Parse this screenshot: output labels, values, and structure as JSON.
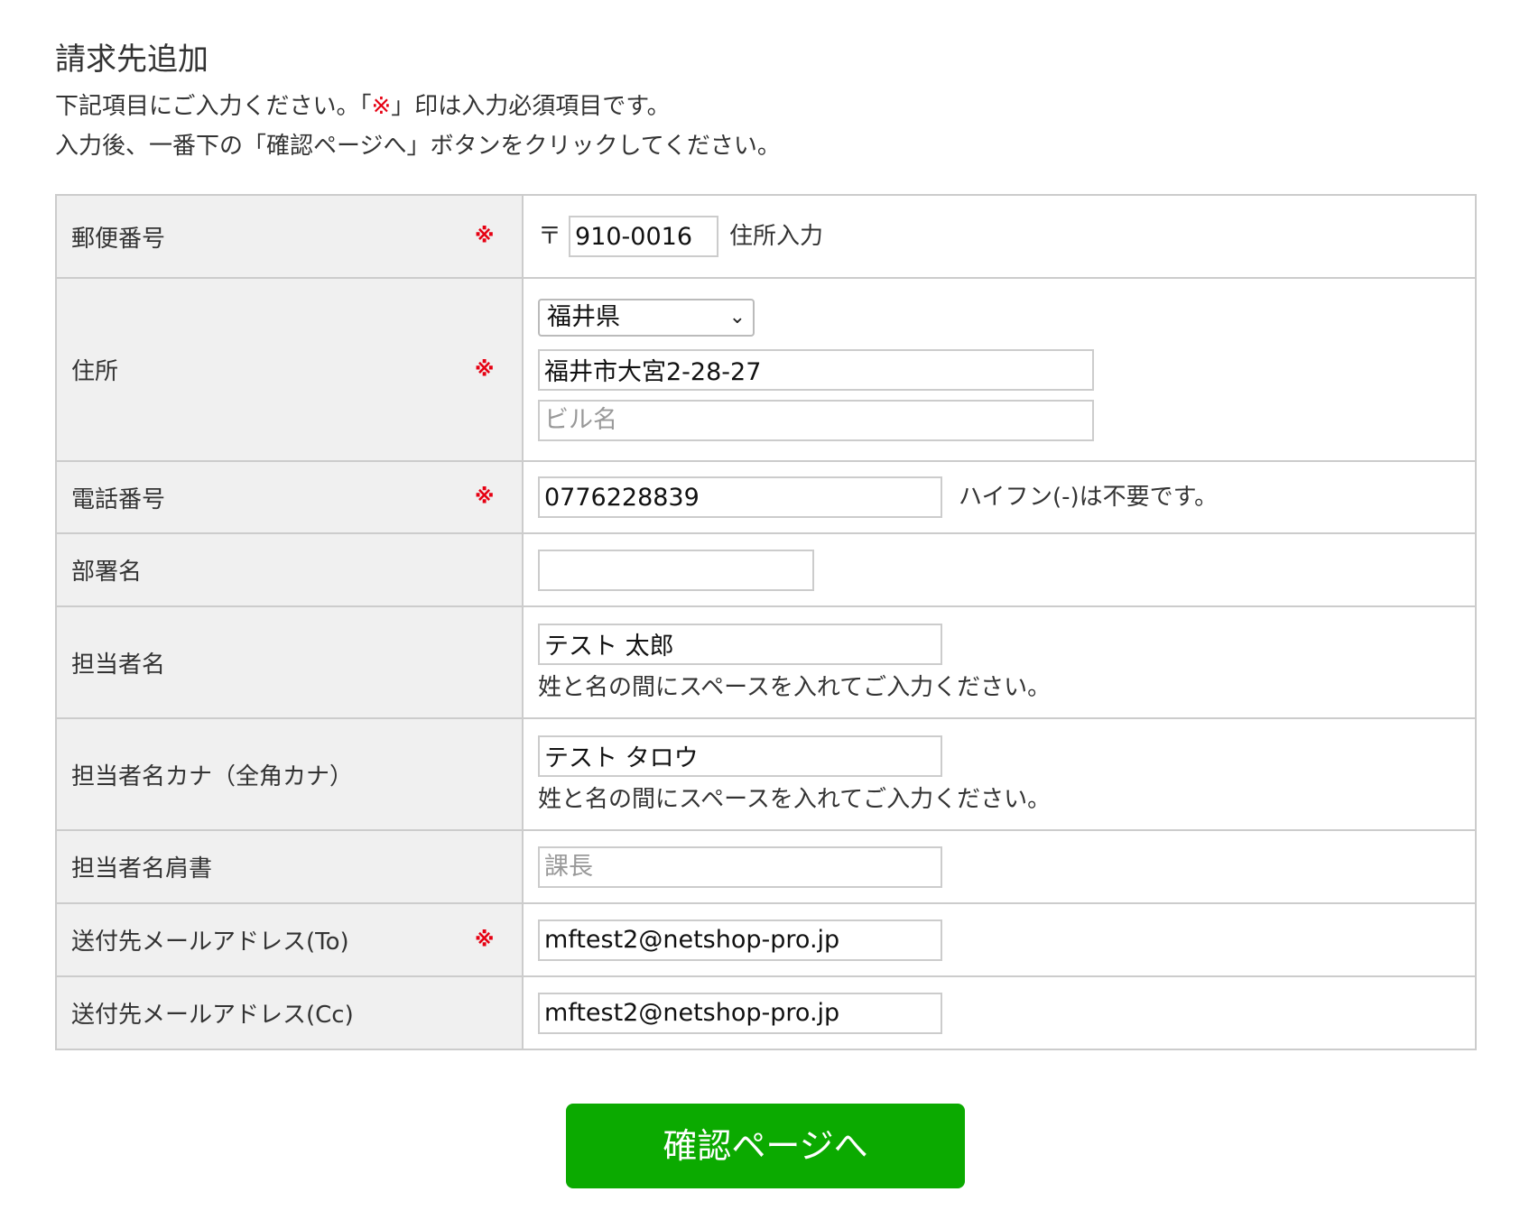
{
  "header": {
    "title": "請求先追加",
    "intro_line1_pre": "下記項目にご入力ください。「",
    "intro_required_mark": "※",
    "intro_line1_post": "」印は入力必須項目です。",
    "intro_line2": "入力後、一番下の「確認ページへ」ボタンをクリックしてください。"
  },
  "required_mark": "※",
  "rows": {
    "postal": {
      "label": "郵便番号",
      "symbol": "〒",
      "value": "910-0016",
      "link": "住所入力"
    },
    "address": {
      "label": "住所",
      "prefecture": "福井県",
      "line1": "福井市大宮2-28-27",
      "building_placeholder": "ビル名"
    },
    "phone": {
      "label": "電話番号",
      "value": "0776228839",
      "note": "ハイフン(-)は不要です。"
    },
    "department": {
      "label": "部署名",
      "value": ""
    },
    "contact_name": {
      "label": "担当者名",
      "value": "テスト 太郎",
      "note": "姓と名の間にスペースを入れてご入力ください。"
    },
    "contact_kana": {
      "label": "担当者名カナ（全角カナ）",
      "value": "テスト タロウ",
      "note": "姓と名の間にスペースを入れてご入力ください。"
    },
    "contact_title": {
      "label": "担当者名肩書",
      "placeholder": "課長"
    },
    "email_to": {
      "label": "送付先メールアドレス(To)",
      "value": "mftest2@netshop-pro.jp"
    },
    "email_cc": {
      "label": "送付先メールアドレス(Cc)",
      "value": "mftest2@netshop-pro.jp"
    }
  },
  "submit_label": "確認ページへ",
  "colors": {
    "accent": "#0baa00",
    "required": "#e60012",
    "label_bg": "#f0f0f0",
    "border": "#cccccc"
  }
}
